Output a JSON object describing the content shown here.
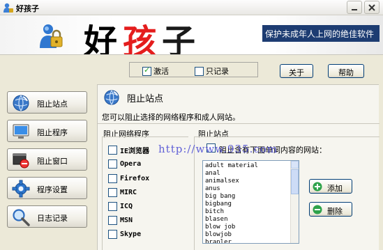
{
  "window": {
    "title": "好孩子"
  },
  "banner": {
    "title_chars": [
      "好",
      "孩",
      "子"
    ],
    "slogan": "保护未成年人上网的绝佳软件"
  },
  "toolbar": {
    "activate_label": "激活",
    "activate_checked": true,
    "record_only_label": "只记录",
    "record_only_checked": false,
    "about_label": "关于",
    "help_label": "帮助"
  },
  "nav": {
    "items": [
      {
        "label": "阻止站点",
        "icon": "globe-icon"
      },
      {
        "label": "阻止程序",
        "icon": "monitor-icon"
      },
      {
        "label": "阻止窗口",
        "icon": "window-block-icon"
      },
      {
        "label": "程序设置",
        "icon": "gear-icon"
      },
      {
        "label": "日志记录",
        "icon": "magnifier-icon"
      }
    ]
  },
  "panel": {
    "title": "阻止站点",
    "description": "您可以阻止选择的网络程序和成人网站。",
    "programs_heading": "阻止网络程序",
    "programs": [
      {
        "label": "IE浏览器",
        "checked": false
      },
      {
        "label": "Opera",
        "checked": false
      },
      {
        "label": "Firefox",
        "checked": false
      },
      {
        "label": "MIRC",
        "checked": false
      },
      {
        "label": "ICQ",
        "checked": false
      },
      {
        "label": "MSN",
        "checked": false
      },
      {
        "label": "Skype",
        "checked": false
      }
    ],
    "sites_heading": "阻止站点",
    "sites_hint": "阻止含有下面单词内容的网站：",
    "sites_checked": false,
    "sites": [
      "adult material",
      "anal",
      "animalsex",
      "anus",
      "big bang",
      "bigbang",
      "bitch",
      "blasen",
      "blow job",
      "blowjob",
      "branler"
    ],
    "add_label": "添加",
    "delete_label": "删除"
  },
  "watermark": "http://www.935.com",
  "colors": {
    "slogan_bg": "#1d3c72",
    "title_red": "#e41d1d",
    "watermark": "#4646d2"
  }
}
